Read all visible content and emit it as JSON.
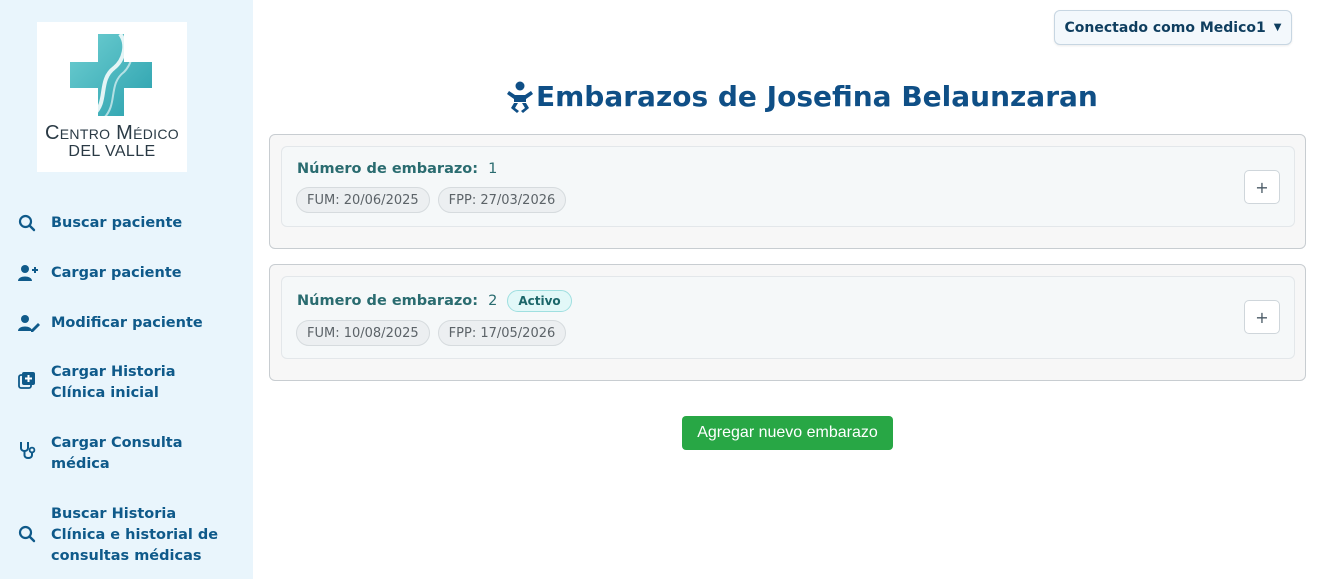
{
  "brand": {
    "line1": "Centro Médico",
    "line2": "DEL VALLE",
    "colors": {
      "cross_top": "#57c0c8",
      "cross_bottom": "#2ea5b1"
    }
  },
  "sidebar": {
    "items": [
      {
        "label": "Buscar paciente",
        "icon": "search-icon"
      },
      {
        "label": "Cargar paciente",
        "icon": "user-plus-icon"
      },
      {
        "label": "Modificar paciente",
        "icon": "user-edit-icon"
      },
      {
        "label": "Cargar Historia Clínica inicial",
        "icon": "document-plus-icon"
      },
      {
        "label": "Cargar Consulta médica",
        "icon": "stethoscope-icon"
      },
      {
        "label": "Buscar Historia Clínica e historial de consultas médicas",
        "icon": "search-icon"
      }
    ]
  },
  "header": {
    "user_label": "Conectado como Medico1",
    "caret": "▼"
  },
  "page": {
    "title": "Embarazos de Josefina Belaunzaran",
    "title_icon": "baby-icon"
  },
  "pregnancies": [
    {
      "label": "Número de embarazo:",
      "number": "1",
      "fum": "FUM: 20/06/2025",
      "fpp": "FPP: 27/03/2026",
      "expand": "+"
    },
    {
      "label": "Número de embarazo:",
      "number": "2",
      "status": "Activo",
      "fum": "FUM: 10/08/2025",
      "fpp": "FPP: 17/05/2026",
      "expand": "+"
    }
  ],
  "actions": {
    "add_label": "Agregar nuevo embarazo"
  },
  "colors": {
    "sidebar_bg": "#e9f5fc",
    "nav_text": "#0f5a8a",
    "title": "#0f4f86",
    "accent_green": "#28a745",
    "row_label": "#2a6c70"
  }
}
